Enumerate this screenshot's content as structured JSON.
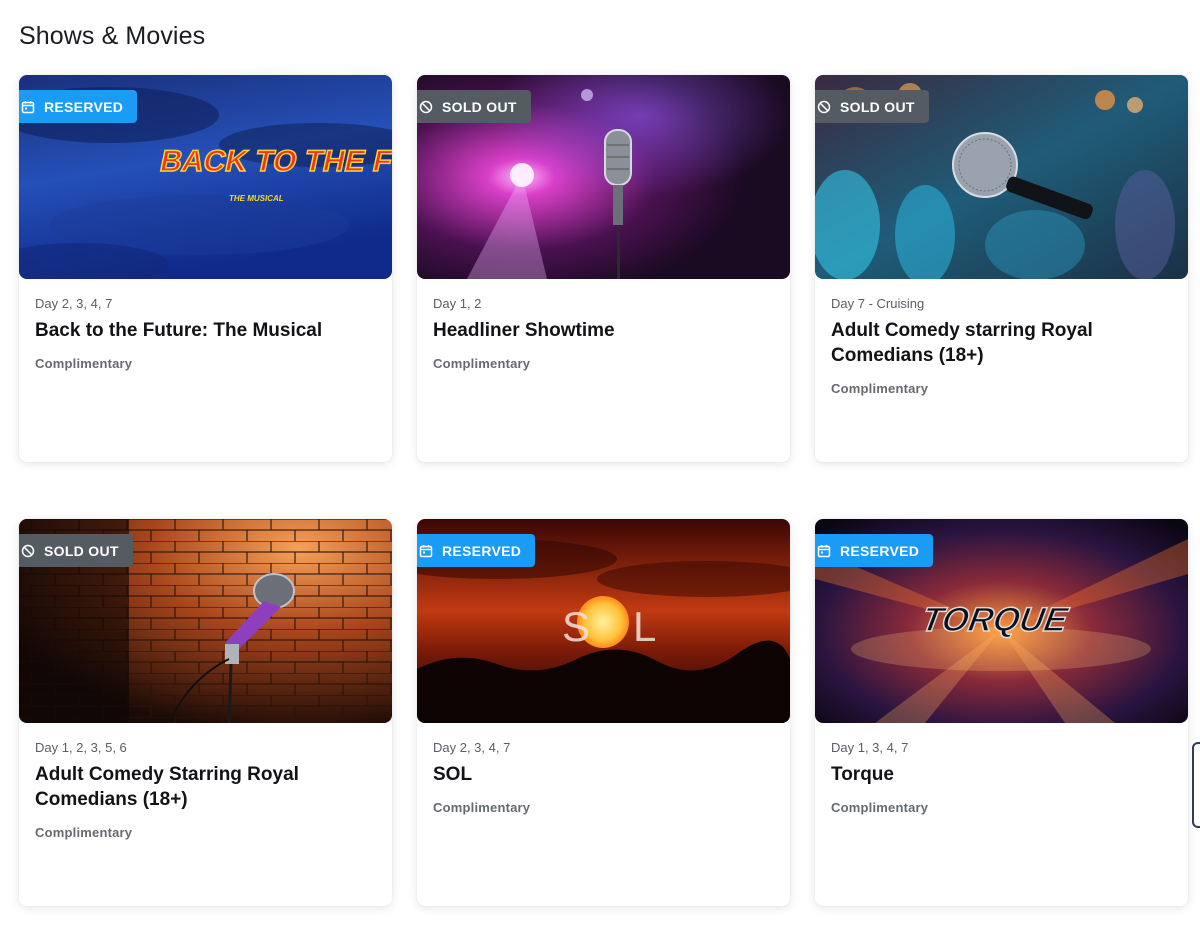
{
  "page": {
    "title": "Shows & Movies"
  },
  "badges": {
    "reserved": "RESERVED",
    "sold_out": "SOLD OUT"
  },
  "icons": {
    "reserved": "calendar-icon",
    "sold_out": "prohibited-icon"
  },
  "colors": {
    "reserved_badge": "#1a9bf5",
    "sold_out_badge": "#555b62"
  },
  "cards": [
    {
      "status": "reserved",
      "days": "Day 2, 3, 4, 7",
      "title": "Back to the Future: The Musical",
      "price": "Complimentary",
      "image_text": "BACK TO THE FUTURE",
      "image_subtext": "THE MUSICAL"
    },
    {
      "status": "sold_out",
      "days": "Day 1, 2",
      "title": "Headliner Showtime",
      "price": "Complimentary"
    },
    {
      "status": "sold_out",
      "days": "Day 7 - Cruising",
      "title": "Adult Comedy starring Royal Comedians (18+)",
      "price": "Complimentary"
    },
    {
      "status": "sold_out",
      "days": "Day 1, 2, 3, 5, 6",
      "title": "Adult Comedy Starring Royal Comedians (18+)",
      "price": "Complimentary"
    },
    {
      "status": "reserved",
      "days": "Day 2, 3, 4, 7",
      "title": "SOL",
      "price": "Complimentary",
      "image_text": "SOL"
    },
    {
      "status": "reserved",
      "days": "Day 1, 3, 4, 7",
      "title": "Torque",
      "price": "Complimentary",
      "image_text": "TORQUE"
    }
  ]
}
